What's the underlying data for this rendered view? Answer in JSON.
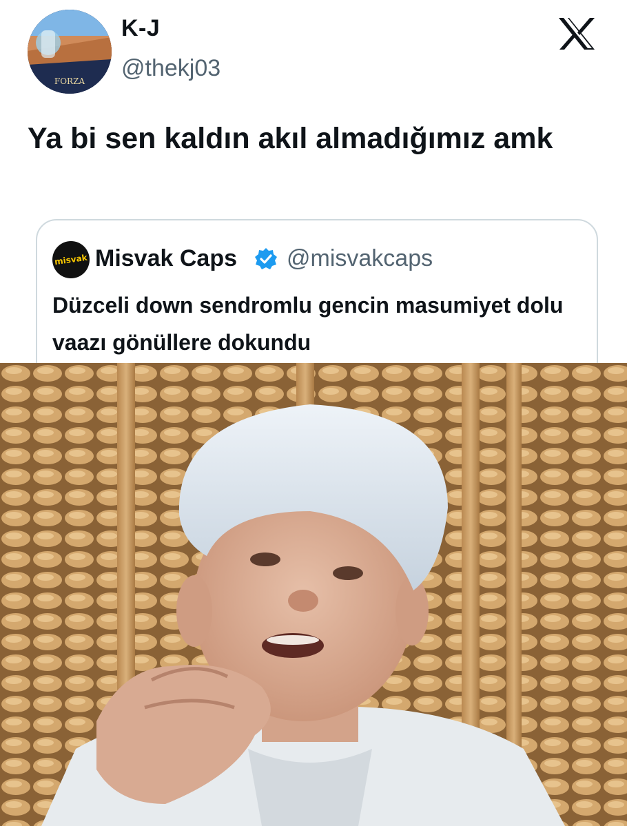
{
  "author": {
    "display_name": "K-J",
    "handle": "@thekj03",
    "avatar_text": "FORZA"
  },
  "tweet": {
    "text": "Ya bi sen kaldın akıl almadığımız amk"
  },
  "quoted": {
    "display_name": "Misvak Caps",
    "handle": "@misvakcaps",
    "avatar_text": "misvak",
    "text": "Düzceli down sendromlu gencin masumiyet dolu vaazı gönüllere dokundu",
    "verified": true
  },
  "icons": {
    "platform": "x-logo-icon",
    "verified": "verified-badge-icon"
  },
  "colors": {
    "text": "#0f1419",
    "secondary": "#536471",
    "verified": "#1d9bf0",
    "border": "#cfd9de",
    "media_bg": "#c9a163"
  }
}
